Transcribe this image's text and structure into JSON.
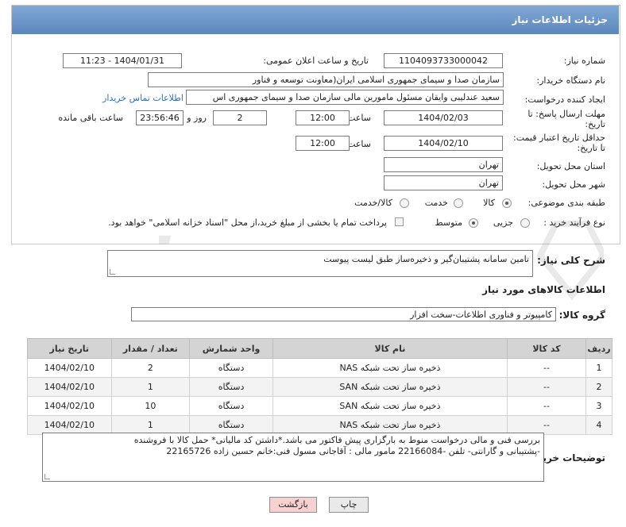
{
  "header": {
    "title": "جزئیات اطلاعات نیاز"
  },
  "form": {
    "need_number": {
      "label": "شماره نیاز:",
      "value": "1104093733000042"
    },
    "announce": {
      "label": "تاریخ و ساعت اعلان عمومی:",
      "value": "1404/01/31 - 11:23"
    },
    "buyer_org": {
      "label": "نام دستگاه خریدار:",
      "value": "سازمان صدا و سیمای جمهوری اسلامی ایران(معاونت توسعه و فناور"
    },
    "requester": {
      "label": "ایجاد کننده درخواست:",
      "value": "سعید عندلیبی وایقان مسئول مامورین مالی  سازمان صدا و سیمای جمهوری اس",
      "contact_link": "اطلاعات تماس خریدار"
    },
    "reply_deadline": {
      "label_line1": "مهلت ارسال پاسخ: تا",
      "label_line2": "تاریخ:",
      "date": "1404/02/03",
      "time_label": "ساعت",
      "time": "12:00",
      "days": "2",
      "days_label": "روز و",
      "remaining": "23:56:46",
      "remaining_label": "ساعت باقی مانده"
    },
    "price_validity": {
      "label_line1": "حداقل تاریخ اعتبار قیمت:",
      "label_line2": "تا تاریخ:",
      "date": "1404/02/10",
      "time_label": "ساعت",
      "time": "12:00"
    },
    "province": {
      "label": "استان محل تحویل:",
      "value": "تهران"
    },
    "city": {
      "label": "شهر محل تحویل:",
      "value": "تهران"
    },
    "category": {
      "label": "طبقه بندی موضوعی:",
      "options": [
        "کالا",
        "خدمت",
        "کالا/خدمت"
      ],
      "selected": "کالا"
    },
    "purchase_type": {
      "label": "نوع فرآیند خرید :",
      "options": [
        "جزیی",
        "متوسط"
      ],
      "selected": "متوسط",
      "payment_note": "پرداخت تمام یا بخشی از مبلغ خرید،از محل \"اسناد خزانه اسلامی\" خواهد بود."
    }
  },
  "description": {
    "label": "شرح کلی نیاز:",
    "value": "تامین سامانه پشتیبان‌گیر و ذخیره‌ساز طبق لیست پیوست"
  },
  "goods_section": {
    "title": "اطلاعات کالاهای مورد نیاز"
  },
  "goods_group": {
    "label": "گروه کالا:",
    "value": "کامپیوتر و فناوری اطلاعات-سخت افزار"
  },
  "table": {
    "headers": [
      "ردیف",
      "کد کالا",
      "نام کالا",
      "واحد شمارش",
      "تعداد / مقدار",
      "تاریخ نیاز"
    ],
    "rows": [
      [
        "1",
        "--",
        "ذخیره ساز تحت شبکه NAS",
        "دستگاه",
        "2",
        "1404/02/10"
      ],
      [
        "2",
        "--",
        "ذخیره ساز تحت شبکه SAN",
        "دستگاه",
        "1",
        "1404/02/10"
      ],
      [
        "3",
        "--",
        "ذخیره ساز تحت شبکه SAN",
        "دستگاه",
        "10",
        "1404/02/10"
      ],
      [
        "4",
        "--",
        "ذخیره ساز تحت شبکه NAS",
        "دستگاه",
        "1",
        "1404/02/10"
      ]
    ]
  },
  "buyer_notes": {
    "label": "توضیحات خریدار:",
    "line1": "بررسی فنی و مالی درخواست منوط به بارگزاری پیش فاکتور می باشد.*داشتن کد مالیاتی*  حمل کالا با فروشنده",
    "line2": "-پشتیبانی و گارانتی- تلفن -22166084 مامور مالی : آقاجانی مسول فنی:خانم حسین زاده 22165726"
  },
  "buttons": {
    "print": "چاپ",
    "back": "بازگشت"
  },
  "watermark": "AriaTender.neT",
  "colors": {
    "header": "#6b93c6",
    "link": "#2f6fb5",
    "back_button": "#f7d0d0",
    "print_button": "#e9e9e9"
  }
}
